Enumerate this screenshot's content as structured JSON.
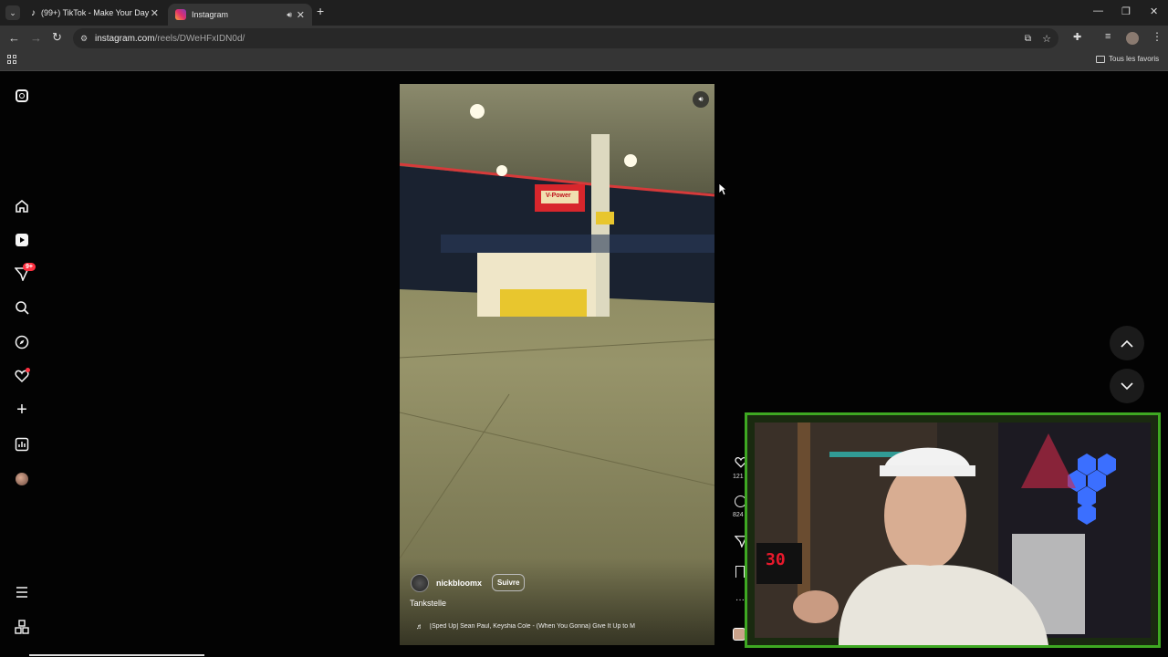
{
  "browser": {
    "tabs": [
      {
        "label": "(99+) TikTok - Make Your Day",
        "active": false
      },
      {
        "label": "Instagram",
        "active": true
      }
    ],
    "address": {
      "domain": "instagram.com",
      "path": "/reels/DWeHFxIDN0d/"
    },
    "bookmarks_label": "Tous les favoris"
  },
  "sidebar": {
    "notification_badge": "9+"
  },
  "reel": {
    "username": "nickbloomx",
    "follow_label": "Suivre",
    "caption": "Tankstelle",
    "music": "[Sped Up]  Sean Paul, Keyshia Cole - (When You Gonna) Give It Up to M",
    "sign_text": "V-Power"
  },
  "actions": {
    "likes": "121",
    "comments": "824"
  },
  "overlay": {
    "timer_text": "30"
  },
  "colors": {
    "badge": "#ff3040",
    "stream_frame": "#3ea822"
  }
}
